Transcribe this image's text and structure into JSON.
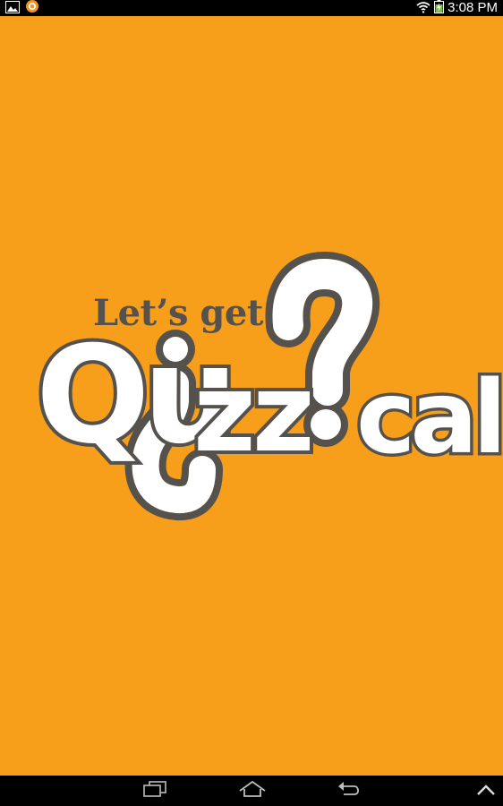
{
  "status_bar": {
    "time": "3:08 PM",
    "left_icons": [
      "gallery-notification-icon",
      "app-notification-icon"
    ],
    "right_icons": [
      "wifi-icon",
      "battery-charging-icon"
    ]
  },
  "splash": {
    "background_color": "#f79f1b",
    "logo": {
      "tagline": "Let’s get",
      "wordmark": "Qu¿zz?cal",
      "text_color": "#ffffff",
      "outline_color": "#55514d",
      "tagline_color": "#55514d"
    }
  },
  "nav_bar": {
    "buttons": [
      "recent-apps-icon",
      "home-icon",
      "back-icon",
      "menu-up-icon"
    ]
  }
}
